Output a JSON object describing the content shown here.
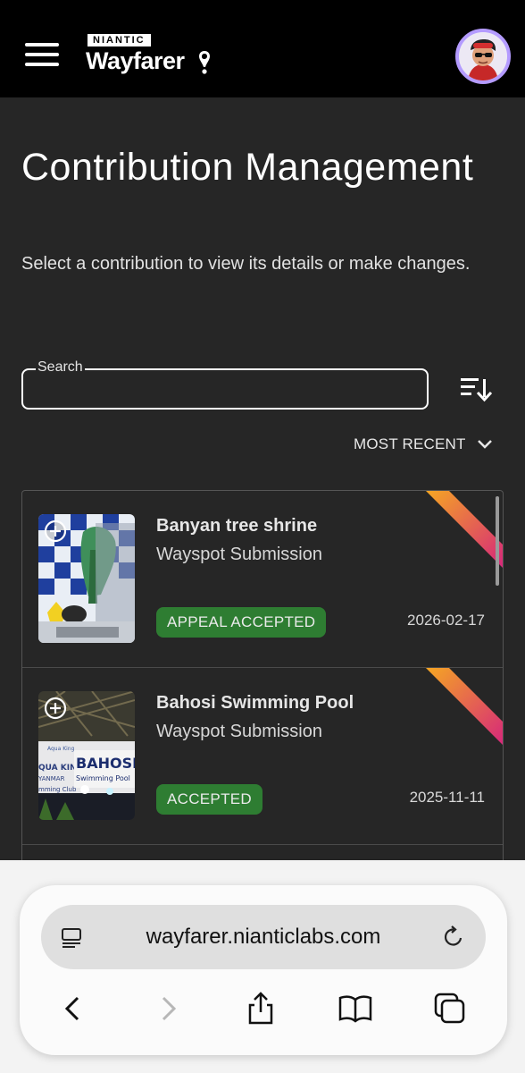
{
  "header": {
    "brand_top": "NIANTIC",
    "brand_name": "Wayfarer",
    "menu_icon": "hamburger-menu-icon",
    "avatar_icon": "user-avatar"
  },
  "page": {
    "title": "Contribution Management",
    "subtitle": "Select a contribution to view its details or make changes."
  },
  "search": {
    "label": "Search",
    "value": ""
  },
  "sort": {
    "icon": "sort-descending-icon",
    "current": "MOST RECENT"
  },
  "contributions": [
    {
      "title": "Banyan tree shrine",
      "type": "Wayspot Submission",
      "status": "APPEAL ACCEPTED",
      "date": "2026-02-17"
    },
    {
      "title": "Bahosi Swimming Pool",
      "type": "Wayspot Submission",
      "status": "ACCEPTED",
      "date": "2025-11-11",
      "thumb_sign": "BAHOSI",
      "thumb_sign2": "Swimming Pool",
      "thumb_sign3": "QUA KING",
      "thumb_sign4": "YANMAR",
      "thumb_sign5": "mming Club"
    }
  ],
  "browser": {
    "url": "wayfarer.nianticlabs.com"
  },
  "colors": {
    "background": "#262626",
    "header": "#000000",
    "badge_green": "#2e7d32",
    "avatar_ring": "#b49bff",
    "corner_gradient_start": "#f5a623",
    "corner_gradient_end": "#d6287a"
  }
}
